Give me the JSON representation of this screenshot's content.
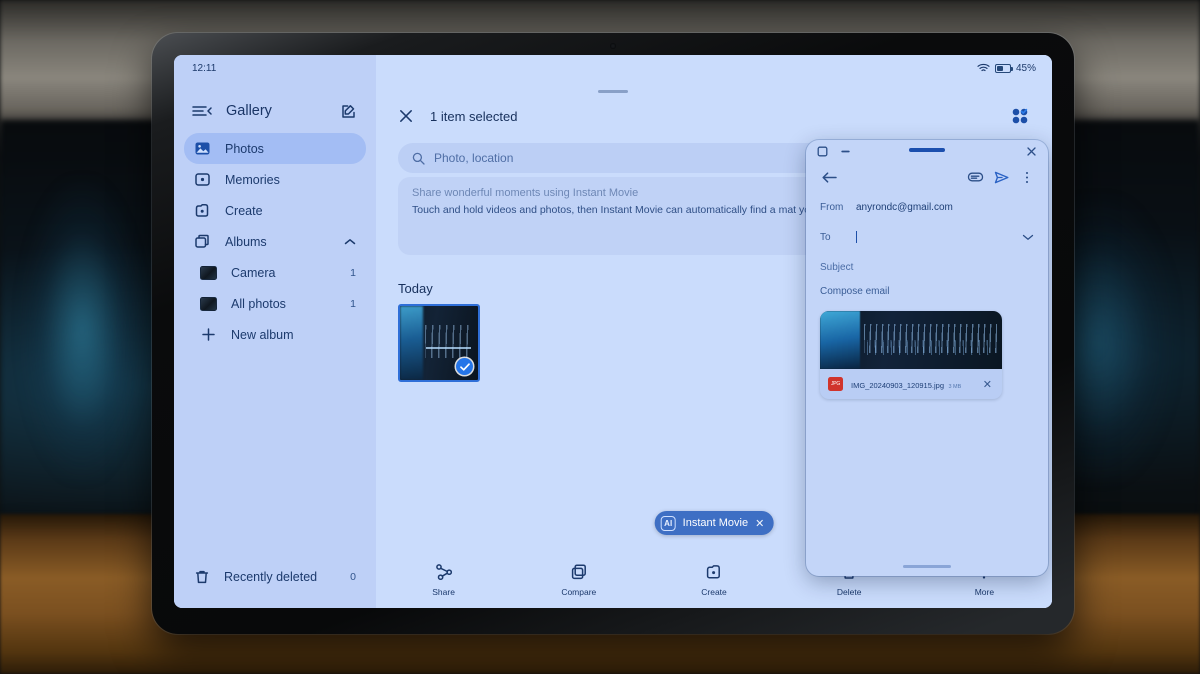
{
  "status_bar": {
    "time": "12:11",
    "battery_percent": "45%",
    "wifi_icon": "wifi-icon",
    "battery_icon": "battery-icon"
  },
  "sidebar": {
    "app_title": "Gallery",
    "menu_icon": "hamburger-collapse-icon",
    "edit_icon": "edit-compose-icon",
    "items": [
      {
        "label": "Photos",
        "icon": "photos-icon",
        "count": "",
        "active": true
      },
      {
        "label": "Memories",
        "icon": "memories-icon",
        "count": "",
        "active": false
      },
      {
        "label": "Create",
        "icon": "create-icon",
        "count": "",
        "active": false
      },
      {
        "label": "Albums",
        "icon": "albums-icon",
        "count": "",
        "active": false,
        "expand_icon": "chevron-up-icon"
      }
    ],
    "albums": [
      {
        "label": "Camera",
        "count": "1"
      },
      {
        "label": "All photos",
        "count": "1"
      }
    ],
    "new_album": {
      "label": "New album",
      "icon": "plus-icon"
    },
    "recently_deleted": {
      "label": "Recently deleted",
      "count": "0",
      "icon": "trash-icon"
    }
  },
  "main": {
    "close_icon": "close-x-icon",
    "selection_text": "1 item selected",
    "select_all_icon": "select-all-icon",
    "search": {
      "placeholder": "Photo, location",
      "icon": "search-icon"
    },
    "promo": {
      "title": "Share wonderful moments using Instant Movie",
      "body": "Touch and hold videos and photos, then Instant Movie can automatically find a mat   you to relive and share."
    },
    "section_title": "Today",
    "photo": {
      "selected": true,
      "check_icon": "check-icon"
    },
    "chip": {
      "ai_label": "AI",
      "label": "Instant Movie",
      "close_icon": "close-x-icon"
    }
  },
  "toolbar": {
    "items": [
      {
        "label": "Share",
        "icon": "share-icon"
      },
      {
        "label": "Compare",
        "icon": "compare-icon"
      },
      {
        "label": "Create",
        "icon": "create-icon"
      },
      {
        "label": "Delete",
        "icon": "trash-icon"
      },
      {
        "label": "More",
        "icon": "more-vertical-icon"
      }
    ]
  },
  "mail_window": {
    "chrome": {
      "maximize_icon": "maximize-icon",
      "minimize_icon": "minimize-icon",
      "close_icon": "close-x-icon",
      "drag_handle": "drag-handle"
    },
    "toolbar": {
      "back_icon": "back-arrow-icon",
      "attach_icon": "attachment-icon",
      "send_icon": "send-icon",
      "more_icon": "more-vertical-icon"
    },
    "from_label": "From",
    "from_value": "anyrondc@gmail.com",
    "to_label": "To",
    "to_value": "",
    "to_expand_icon": "chevron-down-icon",
    "subject_placeholder": "Subject",
    "body_placeholder": "Compose email",
    "attachment": {
      "file_name": "IMG_20240903_120915.jpg",
      "file_size": "3 MB",
      "type_icon": "image-file-icon",
      "remove_icon": "close-x-icon"
    }
  },
  "colors": {
    "screen_bg": "#cadcfc",
    "sidebar_bg": "#bed0f7",
    "active_item": "#a3bdf4",
    "accent_blue": "#2575e8",
    "chip_blue": "#3e6fc4",
    "text_primary": "#17305c",
    "attachment_red": "#d0342c"
  }
}
